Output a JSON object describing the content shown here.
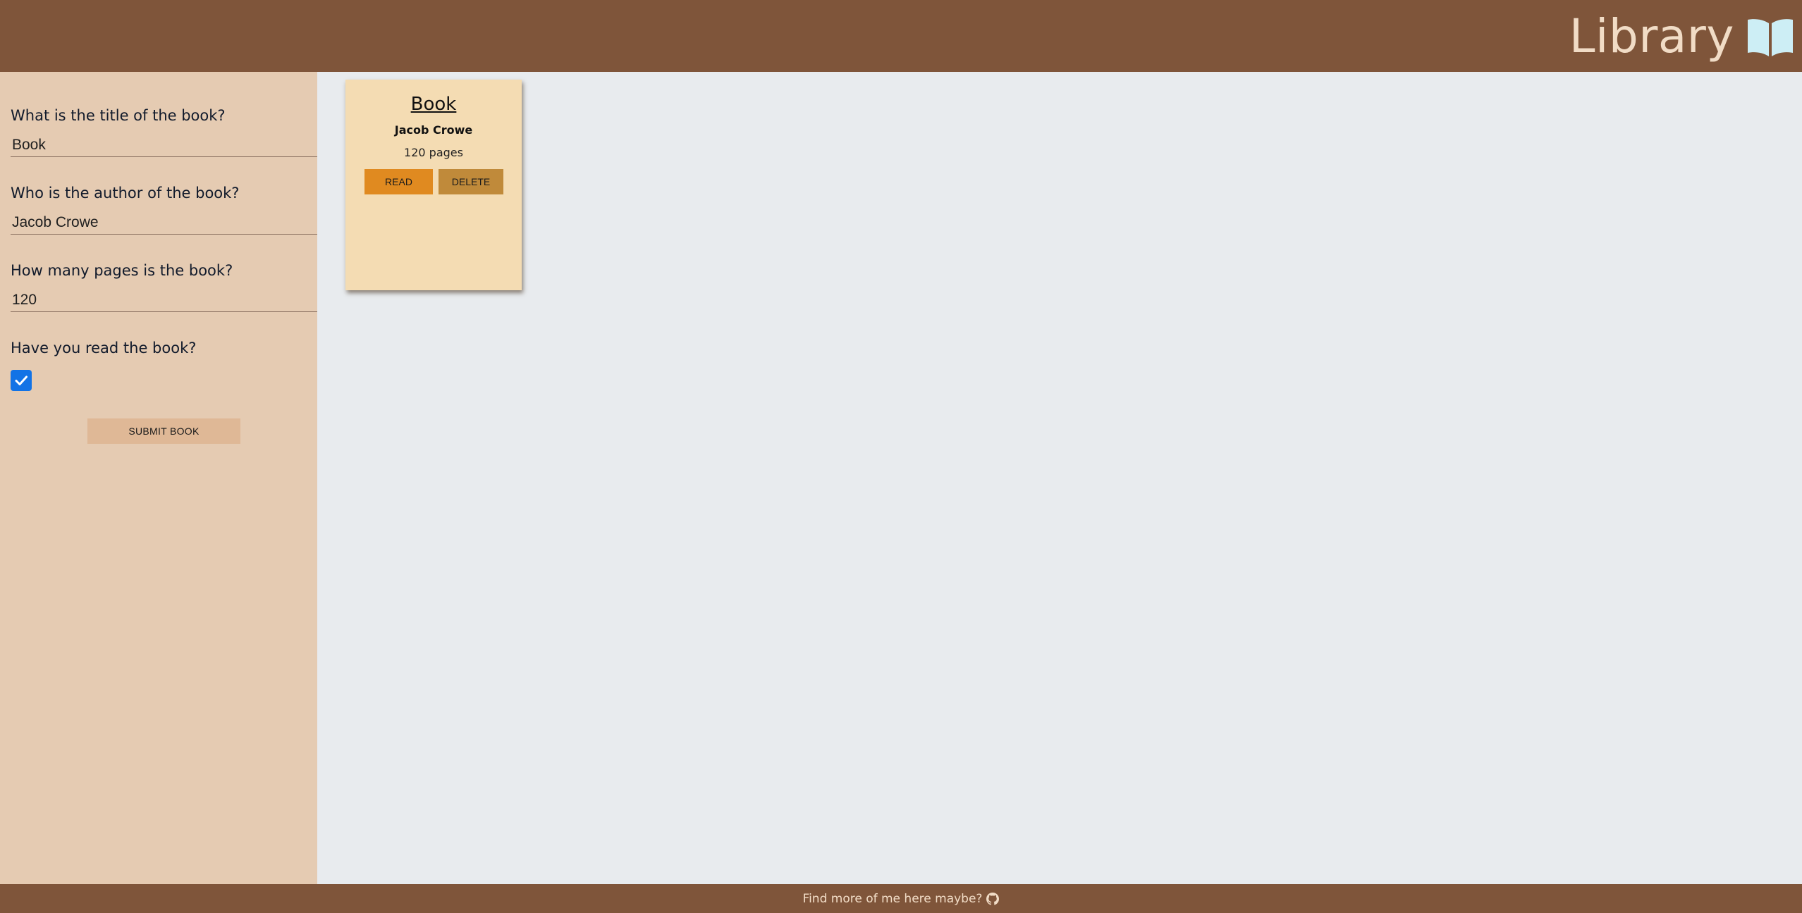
{
  "header": {
    "title": "Library",
    "icon": "open-book-icon",
    "background_color": "#7f553a",
    "icon_color": "#cdeef5"
  },
  "form": {
    "title_label": "What is the title of the book?",
    "title_value": "Book",
    "author_label": "Who is the author of the book?",
    "author_value": "Jacob Crowe",
    "pages_label": "How many pages is the book?",
    "pages_value": "120",
    "read_label": "Have you read the book?",
    "read_checked": true,
    "submit_label": "SUBMIT BOOK",
    "background_color": "#e5cbb2"
  },
  "books": [
    {
      "title": "Book",
      "author": "Jacob Crowe",
      "pages": "120 pages",
      "read_label": "READ",
      "delete_label": "DELETE",
      "read_color": "#e08a20",
      "delete_color": "#c08a3a"
    }
  ],
  "footer": {
    "text": "Find more of me here maybe?",
    "icon": "github-icon"
  }
}
